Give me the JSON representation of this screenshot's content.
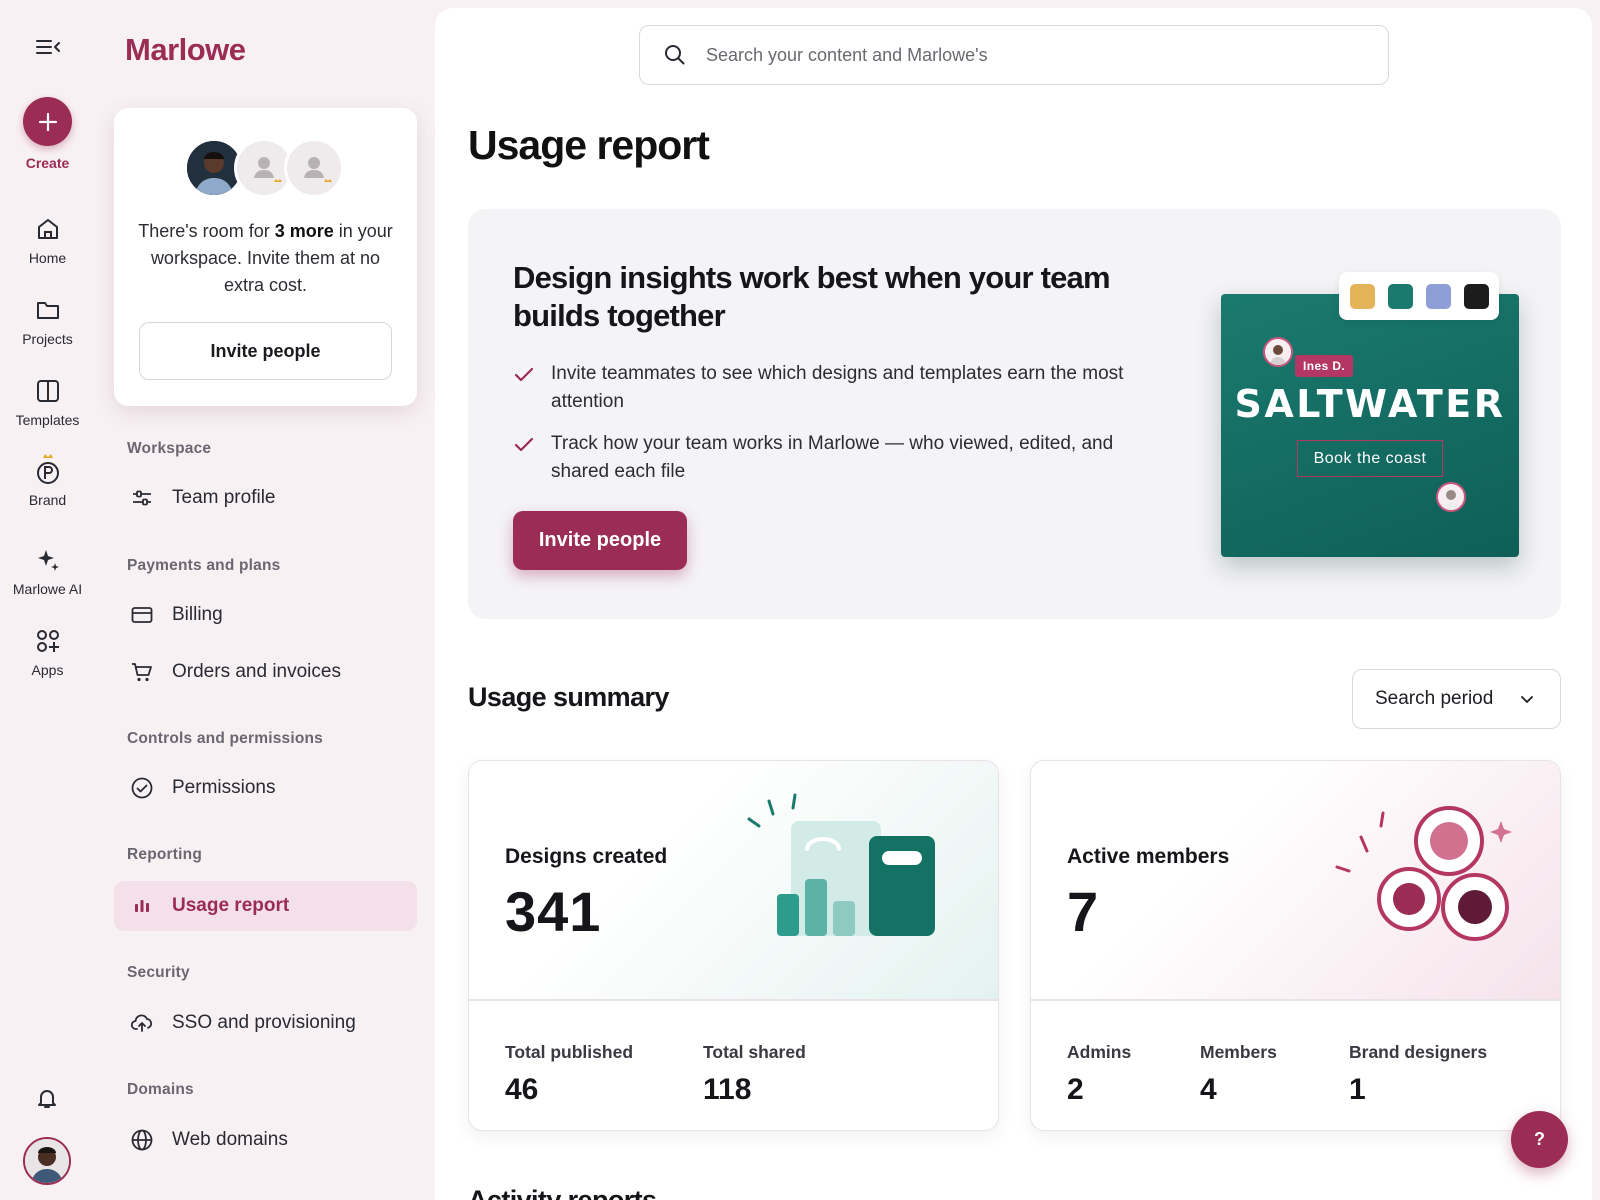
{
  "app": {
    "brand": "Marlowe",
    "create_label": "Create"
  },
  "rail": {
    "items": [
      {
        "label": "Home",
        "icon": "home-icon"
      },
      {
        "label": "Projects",
        "icon": "folder-icon"
      },
      {
        "label": "Templates",
        "icon": "templates-icon"
      },
      {
        "label": "Brand",
        "icon": "brand-icon"
      },
      {
        "label": "Marlowe AI",
        "icon": "sparkle-icon"
      },
      {
        "label": "Apps",
        "icon": "apps-icon"
      }
    ]
  },
  "invite_card": {
    "text_before": "There's room for ",
    "text_bold": "3 more",
    "text_after": " in your workspace. Invite them at no extra cost.",
    "button": "Invite people"
  },
  "sidebar": {
    "sections": [
      {
        "title": "Workspace"
      },
      {
        "title": "Payments and plans"
      },
      {
        "title": "Controls and permissions"
      },
      {
        "title": "Reporting"
      },
      {
        "title": "Security"
      },
      {
        "title": "Domains"
      }
    ],
    "items": [
      {
        "label": "Team profile",
        "icon": "sliders-icon"
      },
      {
        "label": "Billing",
        "icon": "credit-card-icon"
      },
      {
        "label": "Orders and invoices",
        "icon": "cart-icon"
      },
      {
        "label": "Permissions",
        "icon": "check-circle-icon"
      },
      {
        "label": "Usage report",
        "icon": "bar-chart-icon",
        "active": true
      },
      {
        "label": "SSO and provisioning",
        "icon": "cloud-upload-icon"
      },
      {
        "label": "Web domains",
        "icon": "globe-icon"
      }
    ]
  },
  "search": {
    "placeholder": "Search your content and Marlowe's"
  },
  "page": {
    "title": "Usage report"
  },
  "promo": {
    "title": "Design insights work best when your team builds together",
    "points": [
      "Invite teammates to see which designs and templates earn the most attention",
      "Track how your team works in Marlowe — who viewed, edited, and shared each file"
    ],
    "button": "Invite people",
    "preview": {
      "tag": "Ines D.",
      "title": "SALTWATER",
      "subtitle": "Book the coast",
      "swatches": [
        "#e3b35a",
        "#1b7a6e",
        "#8e9ed6",
        "#1c1c1c"
      ]
    }
  },
  "usage_summary": {
    "title": "Usage summary",
    "period_select": "Search period",
    "cards": [
      {
        "label": "Designs created",
        "value": "341",
        "stats": [
          {
            "label": "Total published",
            "value": "46"
          },
          {
            "label": "Total shared",
            "value": "118"
          }
        ]
      },
      {
        "label": "Active members",
        "value": "7",
        "stats": [
          {
            "label": "Admins",
            "value": "2"
          },
          {
            "label": "Members",
            "value": "4"
          },
          {
            "label": "Brand designers",
            "value": "1"
          }
        ]
      }
    ]
  },
  "activity": {
    "title": "Activity reports"
  },
  "help": {
    "label": "?"
  },
  "colors": {
    "accent": "#9b2d55",
    "sidebar_bg": "#f8f1f4",
    "teal": "#1b7a6e"
  }
}
